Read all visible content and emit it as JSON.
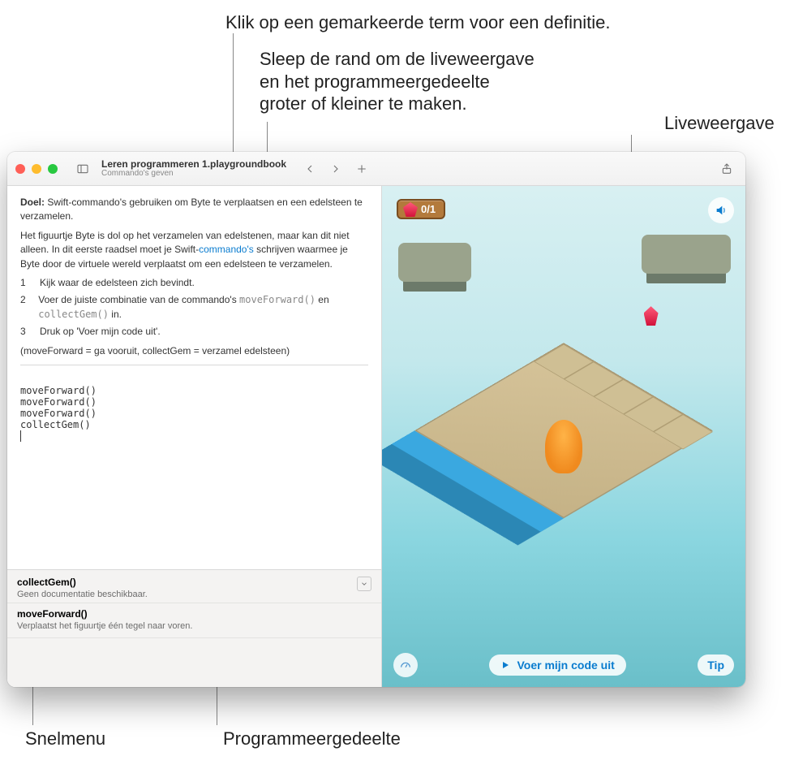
{
  "annotations": {
    "definition": "Klik op een gemarkeerde term voor een definitie.",
    "drag_border": "Sleep de rand om de liveweergave\nen het programmeergedeelte\ngroter of kleiner te maken.",
    "liveview": "Liveweergave",
    "quickmenu": "Snelmenu",
    "coding_area": "Programmeergedeelte"
  },
  "toolbar": {
    "title": "Leren programmeren 1.playgroundbook",
    "subtitle": "Commando's geven"
  },
  "instructions": {
    "goal_label": "Doel:",
    "goal_text": " Swift-commando's gebruiken om Byte te verplaatsen en een edelsteen te verzamelen.",
    "intro_pre": "Het figuurtje Byte is dol op het verzamelen van edelstenen, maar kan dit niet alleen. In dit eerste raadsel moet je Swift-",
    "intro_link": "commando's",
    "intro_post": " schrijven waarmee je Byte door de virtuele wereld verplaatst om een edelsteen te verzamelen.",
    "steps": [
      "Kijk waar de edelsteen zich bevindt.",
      "Voer de juiste combinatie van de commando's moveForward() en collectGem() in.",
      "Druk op 'Voer mijn code uit'."
    ],
    "step2_code1": "moveForward()",
    "step2_code2": "collectGem()",
    "note": "(moveForward = ga vooruit, collectGem = verzamel edelsteen)"
  },
  "code_lines": [
    "moveForward()",
    "moveForward()",
    "moveForward()",
    "collectGem()"
  ],
  "quickmenu": {
    "item1_title": "collectGem()",
    "item1_desc": "Geen documentatie beschikbaar.",
    "item2_title": "moveForward()",
    "item2_desc": "Verplaatst het figuurtje één tegel naar voren."
  },
  "liveview": {
    "gem_progress": "0/1",
    "run_label": "Voer mijn code uit",
    "tip_label": "Tip"
  }
}
